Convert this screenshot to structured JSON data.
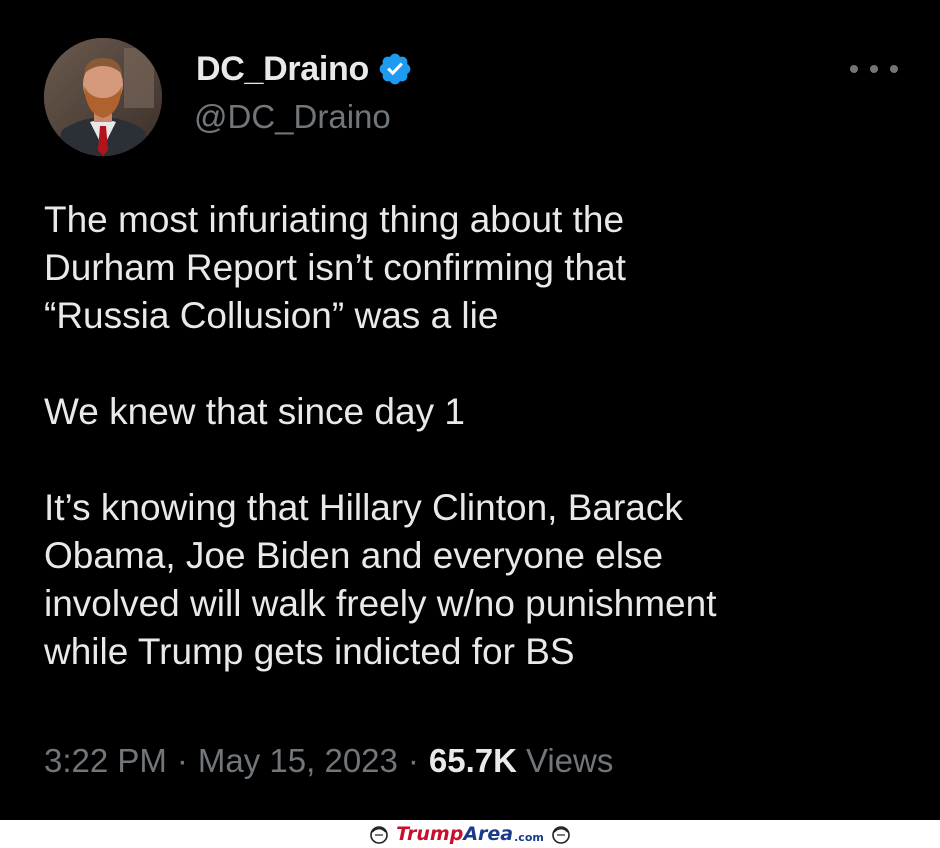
{
  "tweet": {
    "author": {
      "display_name": "DC_Draino",
      "handle": "@DC_Draino",
      "verified": true
    },
    "paragraphs": [
      "The most infuriating thing about the\nDurham Report isn’t confirming that\n“Russia Collusion” was a lie",
      "We knew that since day 1",
      "It’s knowing that Hillary Clinton, Barack\nObama, Joe Biden and everyone else\ninvolved will walk freely w/no punishment\nwhile Trump gets indicted for BS"
    ],
    "time": "3:22 PM",
    "date": "May 15, 2023",
    "separator": "·",
    "views_count": "65.7K",
    "views_label": "Views",
    "icons": {
      "verified": "verified-badge-icon",
      "more": "more-options-icon"
    }
  },
  "watermark": {
    "brand_a": "Trump",
    "brand_b": "Area",
    "suffix": ".com"
  },
  "colors": {
    "background": "#000000",
    "text": "#e7e9ea",
    "secondary_text": "#71767b",
    "verified_blue": "#1d9bf0"
  }
}
